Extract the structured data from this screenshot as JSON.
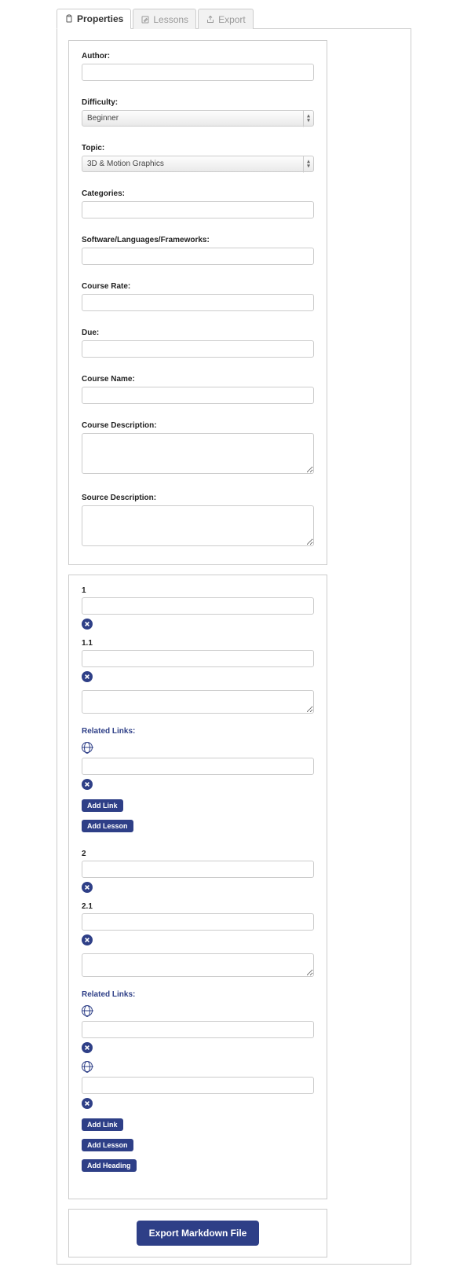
{
  "tabs": {
    "properties": "Properties",
    "lessons": "Lessons",
    "export": "Export"
  },
  "form": {
    "author_label": "Author:",
    "author_value": "",
    "difficulty_label": "Difficulty:",
    "difficulty_value": "Beginner",
    "topic_label": "Topic:",
    "topic_value": "3D & Motion Graphics",
    "categories_label": "Categories:",
    "categories_value": "",
    "software_label": "Software/Languages/Frameworks:",
    "software_value": "",
    "rate_label": "Course Rate:",
    "rate_value": "",
    "due_label": "Due:",
    "due_value": "",
    "name_label": "Course Name:",
    "name_value": "",
    "desc_label": "Course Description:",
    "desc_value": "",
    "source_label": "Source Description:",
    "source_value": ""
  },
  "outline": {
    "sections": [
      {
        "num": "1",
        "value": "",
        "lessons": [
          {
            "num": "1.1",
            "value": "",
            "extra_value": "",
            "related_label": "Related Links:",
            "links": [
              {
                "value": ""
              }
            ]
          }
        ]
      },
      {
        "num": "2",
        "value": "",
        "lessons": [
          {
            "num": "2.1",
            "value": "",
            "extra_value": "",
            "related_label": "Related Links:",
            "links": [
              {
                "value": ""
              },
              {
                "value": ""
              }
            ]
          }
        ]
      }
    ],
    "add_link_label": "Add Link",
    "add_lesson_label": "Add Lesson",
    "add_heading_label": "Add Heading"
  },
  "export_button": "Export Markdown File"
}
